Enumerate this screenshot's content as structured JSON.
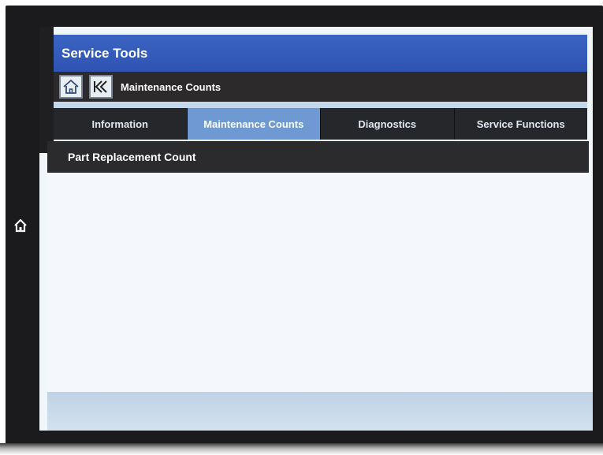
{
  "screen": {
    "title": "Service Tools",
    "nav": {
      "home_icon": "home-icon",
      "back_icon": "double-back-icon",
      "breadcrumb": "Maintenance Counts"
    },
    "tabs": [
      {
        "label": "Information",
        "active": false
      },
      {
        "label": "Maintenance Counts",
        "active": true
      },
      {
        "label": "Diagnostics",
        "active": false
      },
      {
        "label": "Service Functions",
        "active": false
      }
    ],
    "section_title": "Part Replacement Count"
  },
  "device": {
    "home_button_icon": "home-icon"
  },
  "colors": {
    "title_bar": "#3560bd",
    "active_tab": "#6e99d3",
    "dark_bar": "#2b2b2e"
  }
}
